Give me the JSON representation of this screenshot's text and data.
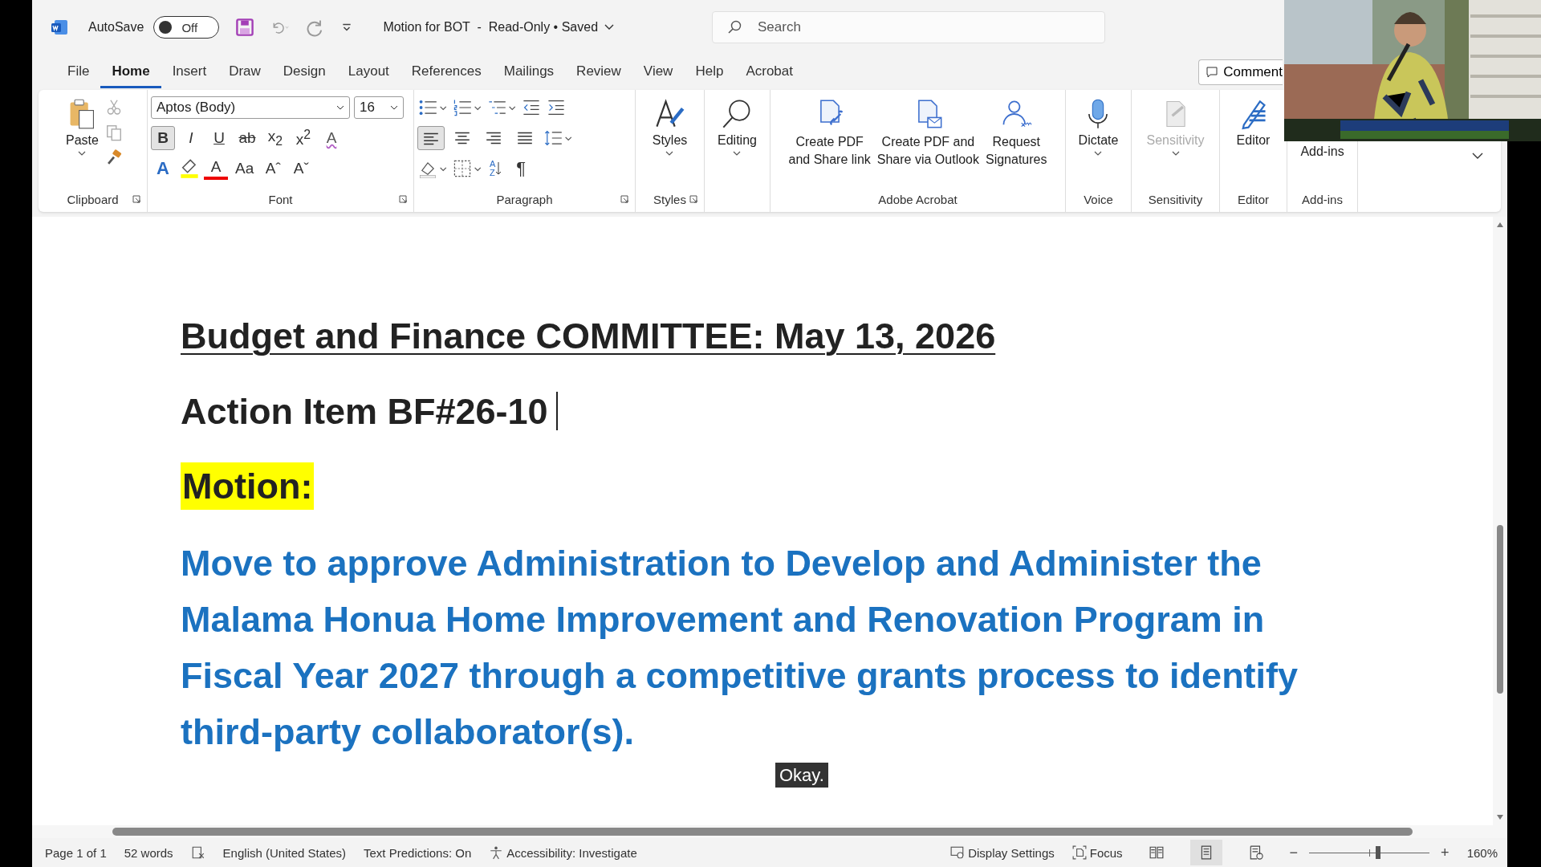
{
  "title_bar": {
    "autosave_label": "AutoSave",
    "autosave": {
      "on": false,
      "label": "Off"
    },
    "document_title": "Motion for BOT  -  Read-Only • Saved",
    "search": {
      "placeholder": "Search"
    }
  },
  "tabs": [
    {
      "label": "File",
      "selected": false
    },
    {
      "label": "Home",
      "selected": true
    },
    {
      "label": "Insert",
      "selected": false
    },
    {
      "label": "Draw",
      "selected": false
    },
    {
      "label": "Design",
      "selected": false
    },
    {
      "label": "Layout",
      "selected": false
    },
    {
      "label": "References",
      "selected": false
    },
    {
      "label": "Mailings",
      "selected": false
    },
    {
      "label": "Review",
      "selected": false
    },
    {
      "label": "View",
      "selected": false
    },
    {
      "label": "Help",
      "selected": false
    },
    {
      "label": "Acrobat",
      "selected": false
    }
  ],
  "comments_button": "Comment",
  "ribbon": {
    "clipboard": {
      "paste": "Paste",
      "label": "Clipboard"
    },
    "font": {
      "font_name": "Aptos (Body)",
      "font_size": "16",
      "label": "Font",
      "format_buttons": [
        {
          "kind": "toggle",
          "label": "B",
          "pressed": true
        },
        {
          "kind": "toggle",
          "label": "I",
          "pressed": false
        },
        {
          "kind": "toggle",
          "label": "U",
          "pressed": false
        },
        {
          "kind": "strike",
          "label": "ab",
          "pressed": false
        },
        {
          "kind": "toggle",
          "label": "x$_{2}$",
          "pressed": false
        },
        {
          "kind": "toggle",
          "label": "x$^{2}$",
          "pressed": false
        },
        {
          "kind": "eraser",
          "label": "A"
        }
      ],
      "color_buttons": [
        {
          "kind": "effects",
          "label": "A"
        },
        {
          "kind": "highlight"
        },
        {
          "kind": "color",
          "label": "A"
        },
        {
          "kind": "case",
          "label": "Aa"
        },
        {
          "kind": "plain",
          "label": "Aˆ"
        },
        {
          "kind": "plain",
          "label": "Aˇ"
        }
      ]
    },
    "paragraph": {
      "label": "Paragraph",
      "align": [
        {
          "kind": "left",
          "selected": true
        },
        {
          "kind": "center",
          "selected": false
        },
        {
          "kind": "right",
          "selected": false
        },
        {
          "kind": "justify",
          "selected": false
        }
      ],
      "sort_label": "AZ",
      "marks_label": "¶"
    },
    "styles": {
      "button": "Styles",
      "label": "Styles"
    },
    "editing": {
      "button": "Editing"
    },
    "acrobat": {
      "buttons": [
        {
          "kind": "link",
          "label": "Create PDF\nand Share link"
        },
        {
          "kind": "mail",
          "label": "Create PDF and\nShare via Outlook"
        },
        {
          "kind": "sign",
          "label": "Request\nSignatures"
        }
      ],
      "label": "Adobe Acrobat"
    },
    "voice": {
      "button": "Dictate",
      "label": "Voice"
    },
    "sensitivity": {
      "button": "Sensitivity",
      "disabled": true,
      "label": "Sensitivity"
    },
    "editor": {
      "button": "Editor",
      "label": "Editor"
    },
    "addins": {
      "button": "Add-ins",
      "label": "Add-ins"
    }
  },
  "document": {
    "paragraphs": [
      {
        "kind": "title",
        "text": "Budget and Finance COMMITTEE: May 13, 2026",
        "highlighted": false,
        "cursor": false
      },
      {
        "kind": "heading",
        "text": "Action Item BF#26-10",
        "highlighted": false,
        "cursor": true
      },
      {
        "kind": "heading",
        "text": "Motion:",
        "highlighted": true,
        "cursor": false
      },
      {
        "kind": "motion",
        "text": "Move to approve Administration to Develop and Administer the Malama Honua Home Improvement and Renovation Program in Fiscal Year 2027 through a competitive grants process to identify third-party collaborator(s).",
        "highlighted": false,
        "cursor": false
      }
    ]
  },
  "caption": "Okay.",
  "status_bar": {
    "page": "Page 1 of 1",
    "words": "52 words",
    "language": "English (United States)",
    "predictions": "Text Predictions: On",
    "accessibility": "Accessibility: Investigate",
    "display_settings": "Display Settings",
    "focus": "Focus",
    "views": [
      {
        "kind": "read",
        "selected": false
      },
      {
        "kind": "print",
        "selected": true
      },
      {
        "kind": "web",
        "selected": false
      }
    ],
    "zoom": {
      "minus": "−",
      "plus": "+",
      "level": 0.57,
      "percent": "160%"
    }
  }
}
